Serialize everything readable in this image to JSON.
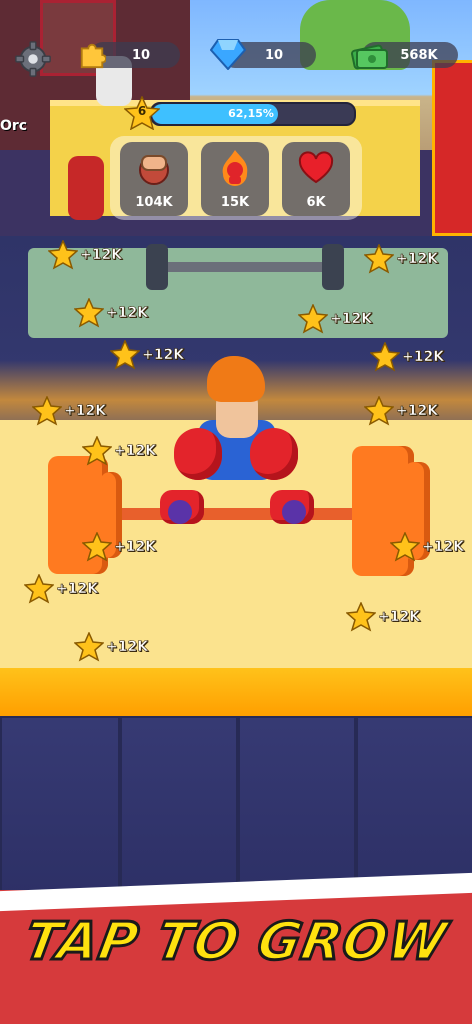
{
  "hud": {
    "puzzle_count": "10",
    "gem_count": "10",
    "cash_amount": "568K",
    "level": "6",
    "progress_text": "62,15%",
    "progress_value": 0.6215
  },
  "stats": [
    {
      "label": "104K",
      "icon": "fist-icon"
    },
    {
      "label": "15K",
      "icon": "fire-hero-icon"
    },
    {
      "label": "6K",
      "icon": "heart-icon"
    }
  ],
  "scene": {
    "shop_sign_partial": "Orc"
  },
  "floating_rewards": [
    "+12K",
    "+12K",
    "+12K",
    "+12K",
    "+12K",
    "+12K",
    "+12K",
    "+12K",
    "+12K",
    "+12K",
    "+12K",
    "+12K",
    "+12K",
    "+12K",
    "+12K"
  ],
  "banner": {
    "text": "TAP TO GROW"
  },
  "colors": {
    "banner_bg": "#d63a3c",
    "banner_text": "#ffe20f",
    "progress_fill": "#3ec0ff",
    "platform": "#fbe38e"
  }
}
